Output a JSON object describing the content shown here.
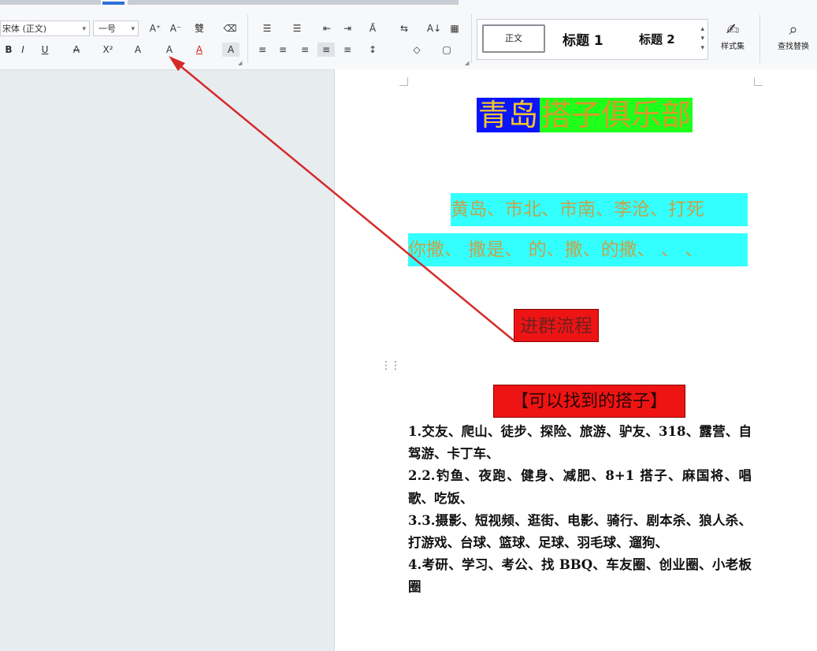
{
  "ribbon": {
    "font_name": "宋体 (正文)",
    "font_size": "一号",
    "tools_row1": [
      "A⁺",
      "A⁻",
      "雙",
      "⌫",
      "☰",
      "☰",
      "⇤",
      "⇥",
      "A̋",
      "⇆",
      "A↓",
      "▦"
    ],
    "tools_row2": [
      "B",
      "I",
      "U",
      "A",
      "X²",
      "A",
      "A",
      "A",
      "A",
      "≡",
      "≡",
      "≡",
      "≡",
      "≡",
      "↕",
      "◇",
      "▢"
    ],
    "styles": {
      "normal": "正文",
      "heading1": "标题 1",
      "heading2": "标题 2"
    },
    "style_set_label": "样式集",
    "find_replace_label": "查找替换"
  },
  "document": {
    "title_part1": "青岛",
    "title_part2": "搭子俱乐部",
    "line1": "黄岛、市北、市南、李沧、打死",
    "line2": "你撒、 撒是、 的、撒、的撒、 、 、",
    "section_title": "进群流程",
    "subheading": "【可以找到的搭子】",
    "items": [
      "1.交友、爬山、徒步、探险、旅游、驴友、318、露营、自驾游、卡丁车、",
      "2.2.钓鱼、夜跑、健身、减肥、8+1 搭子、麻国将、唱歌、吃饭、",
      "3.3.摄影、短视频、逛街、电影、骑行、剧本杀、狼人杀、打游戏、台球、篮球、足球、羽毛球、遛狗、",
      "4.考研、学习、考公、找 BBQ、车友圈、创业圈、小老板圈"
    ]
  },
  "colors": {
    "highlight_blue": "#0a14ff",
    "highlight_green": "#1fff1a",
    "highlight_cyan": "#34ffff",
    "highlight_red": "#ee1414",
    "arrow": "#d62a2a"
  }
}
